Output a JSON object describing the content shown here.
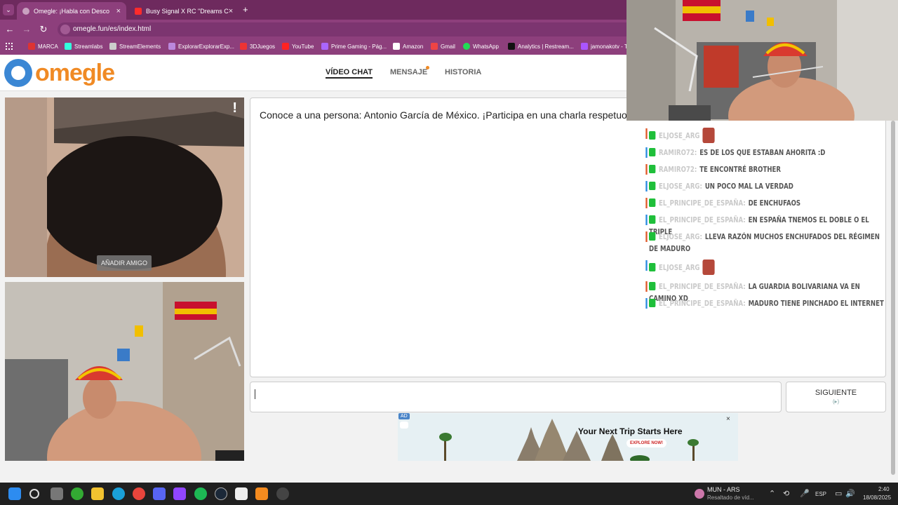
{
  "browser": {
    "tabs": [
      {
        "title": "Omegle: ¡Habla con Desco",
        "active": true
      },
      {
        "title": "Busy Signal X RC \"Dreams C",
        "active": false
      }
    ],
    "new_tab": "+",
    "url": "omegle.fun/es/index.html",
    "bookmarks": [
      "MARCA",
      "Streamlabs",
      "StreamElements",
      "ExplorarExplorarExp...",
      "3DJuegos",
      "YouTube",
      "Prime Gaming - Pág...",
      "Amazon",
      "Gmail",
      "WhatsApp",
      "Analytics | Restream...",
      "jamonakotv - T"
    ]
  },
  "site": {
    "logo_text": "omegle",
    "nav": [
      {
        "label": "VÍDEO CHAT",
        "active": true
      },
      {
        "label": "MENSAJE",
        "active": false
      },
      {
        "label": "HISTORIA",
        "active": false
      }
    ]
  },
  "video": {
    "report_mark": "!",
    "add_friend": "AÑADIR AMIGO"
  },
  "chat": {
    "intro": "Conoce a una persona: Antonio García de México. ¡Participa en una charla respetuosa y",
    "input_value": "",
    "next_label": "SIGUIENTE",
    "next_hint": "(▸)"
  },
  "ad": {
    "badge": "AD",
    "headline": "Your Next Trip Starts Here",
    "cta": "EXPLORE NOW!",
    "close": "×"
  },
  "stream_chat": [
    {
      "user": "ELJOSE_ARG",
      "text": "",
      "emote": true,
      "color": "#e05a2b"
    },
    {
      "user": "RAMIRO72:",
      "text": "ES DE LOS QUE ESTABAN AHORITA :D",
      "emote": false,
      "color": "#2b8be0"
    },
    {
      "user": "RAMIRO72:",
      "text": "TE ENCONTRÉ BROTHER",
      "emote": false,
      "color": "#e05a2b"
    },
    {
      "user": "ELJOSE_ARG:",
      "text": "UN POCO MAL LA VERDAD",
      "emote": false,
      "color": "#2b8be0"
    },
    {
      "user": "EL_PRINCIPE_DE_ESPAÑA:",
      "text": "DE ENCHUFAOS",
      "emote": false,
      "color": "#e05a2b"
    },
    {
      "user": "EL_PRINCIPE_DE_ESPAÑA:",
      "text": "EN ESPAÑA TNEMOS EL DOBLE O EL TRIPLE",
      "emote": false,
      "color": "#2b8be0"
    },
    {
      "user": "ELJOSE_ARG:",
      "text": "LLEVA RAZÓN MUCHOS ENCHUFADOS DEL RÉGIMEN DE MADURO",
      "emote": false,
      "color": "#e05a2b"
    },
    {
      "user": "ELJOSE_ARG",
      "text": "",
      "emote": true,
      "color": "#2b8be0"
    },
    {
      "user": "EL_PRINCIPE_DE_ESPAÑA:",
      "text": "LA GUARDIA BOLIVARIANA VA EN CAMINO XD",
      "emote": false,
      "color": "#e05a2b"
    },
    {
      "user": "EL_PRINCIPE_DE_ESPAÑA:",
      "text": "MADURO TIENE PINCHADO EL INTERNET",
      "emote": false,
      "color": "#2b8be0"
    }
  ],
  "taskbar": {
    "widget_title": "MUN - ARS",
    "widget_sub": "Resaltado de víd...",
    "lang": "ESP",
    "time": "2:40",
    "date": "18/08/2025"
  }
}
